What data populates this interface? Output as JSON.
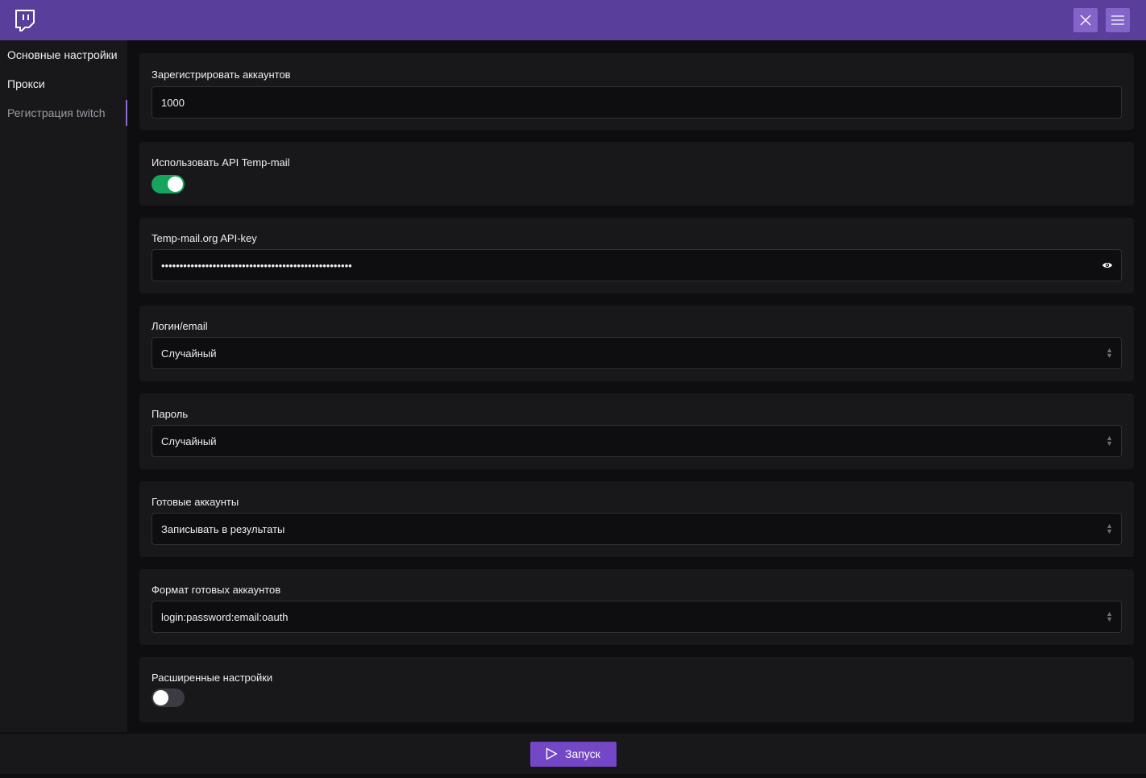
{
  "topbar": {
    "logo_icon": "twitch-icon",
    "close_icon": "close-icon",
    "menu_icon": "hamburger-icon"
  },
  "sidebar": {
    "items": [
      {
        "label": "Основные настройки"
      },
      {
        "label": "Прокси"
      },
      {
        "label": "Регистрация twitch"
      }
    ]
  },
  "form": {
    "accounts_count": {
      "label": "Зарегистрировать аккаунтов",
      "value": "1000"
    },
    "use_tempmail": {
      "label": "Использовать API Temp-mail",
      "enabled": true
    },
    "api_key": {
      "label": "Temp-mail.org API-key",
      "masked": "••••••••••••••••••••••••••••••••••••••••••••••••••••"
    },
    "login": {
      "label": "Логин/email",
      "selected": "Случайный"
    },
    "password": {
      "label": "Пароль",
      "selected": "Случайный"
    },
    "ready_accounts": {
      "label": "Готовые аккаунты",
      "selected": "Записывать в результаты"
    },
    "format": {
      "label": "Формат готовых аккаунтов",
      "selected": "login:password:email:oauth"
    },
    "advanced": {
      "label": "Расширенные настройки",
      "enabled": false
    }
  },
  "footer": {
    "run_label": "Запуск"
  },
  "colors": {
    "brand": "#5a3e9b",
    "accent_button": "#7347c5",
    "toggle_on": "#16a55d"
  }
}
